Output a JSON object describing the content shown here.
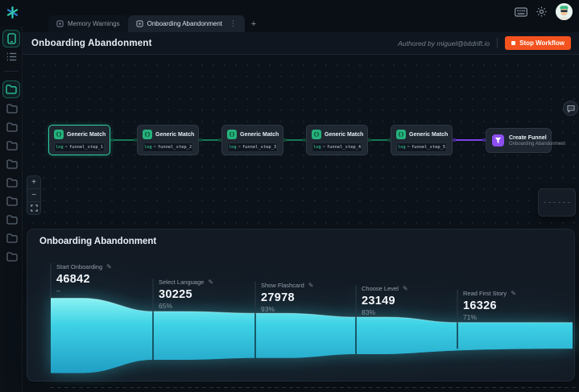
{
  "topbar": {
    "tabs": [
      {
        "label": "Memory Warnings",
        "active": false
      },
      {
        "label": "Onboarding Abandonment",
        "active": true
      }
    ],
    "new_tab_label": "+",
    "kebab": "⋮"
  },
  "workflow": {
    "title": "Onboarding Abandonment",
    "authored_by": "Authored by miguel@bitdrift.io",
    "stop_button_label": "Stop Workflow",
    "nodes": [
      {
        "title": "Generic Match",
        "icon_glyph": "{}",
        "key": "log",
        "op": "=",
        "value": "funnel_step_1",
        "selected": true
      },
      {
        "title": "Generic Match",
        "icon_glyph": "{}",
        "key": "log",
        "op": "=",
        "value": "funnel_step_2",
        "selected": false
      },
      {
        "title": "Generic Match",
        "icon_glyph": "{}",
        "key": "log",
        "op": "=",
        "value": "funnel_step_3",
        "selected": false
      },
      {
        "title": "Generic Match",
        "icon_glyph": "{}",
        "key": "log",
        "op": "=",
        "value": "funnel_step_4",
        "selected": false
      },
      {
        "title": "Generic Match",
        "icon_glyph": "{}",
        "key": "log",
        "op": "=",
        "value": "funnel_step_5",
        "selected": false
      }
    ],
    "output_node": {
      "title": "Create Funnel",
      "subtitle": "Onboarding Abandonment"
    },
    "zoom_controls": {
      "zoom_in": "+",
      "zoom_out": "−"
    }
  },
  "funnel_panel": {
    "title": "Onboarding Abandonment"
  },
  "chart_data": {
    "type": "funnel",
    "title": "Onboarding Abandonment",
    "stages": [
      {
        "label": "Start Onboarding",
        "value": 46842,
        "pct": "–"
      },
      {
        "label": "Select Language",
        "value": 30225,
        "pct": "65%"
      },
      {
        "label": "Show Flashcard",
        "value": 27978,
        "pct": "93%"
      },
      {
        "label": "Choose Level",
        "value": 23149,
        "pct": "83%"
      },
      {
        "label": "Read First Story",
        "value": 16326,
        "pct": "71%"
      }
    ],
    "fill_top": "#8bf2f2",
    "fill_mid": "#3ed2e6",
    "fill_bottom": "#1f9ec4"
  },
  "colors": {
    "accent_teal": "#2ecfa4",
    "accent_purple": "#8b4ef0",
    "stop_orange": "#f4521e"
  }
}
